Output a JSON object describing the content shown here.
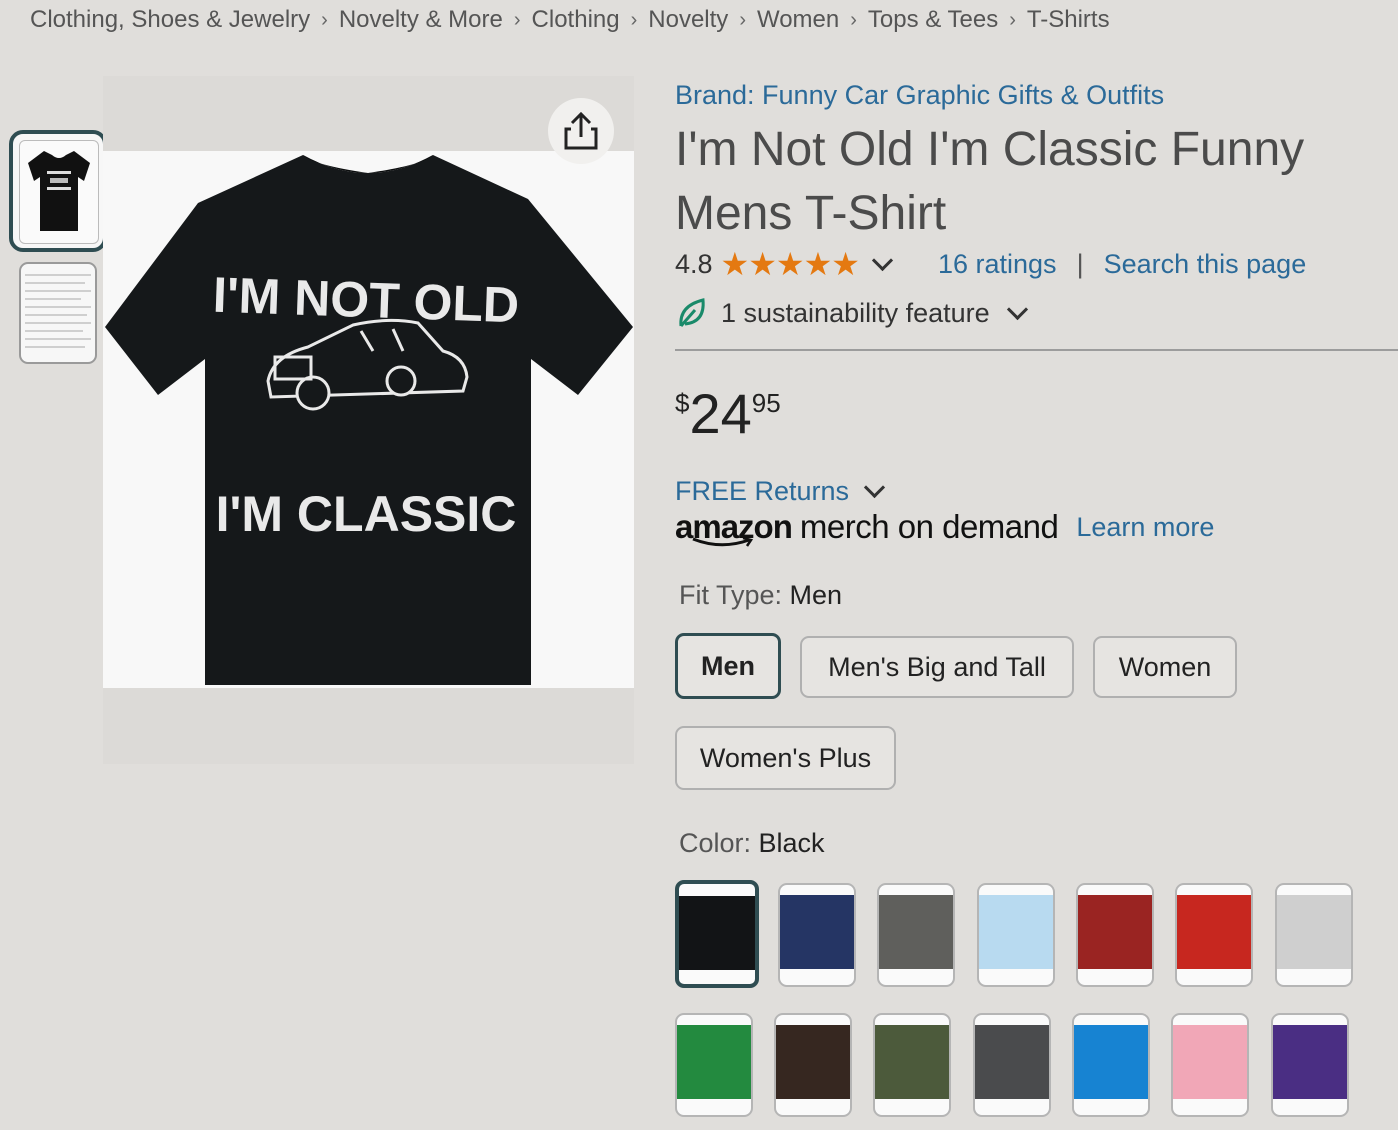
{
  "breadcrumb": [
    "Clothing, Shoes & Jewelry",
    "Novelty & More",
    "Clothing",
    "Novelty",
    "Women",
    "Tops & Tees",
    "T-Shirts"
  ],
  "breadcrumb_separator": "›",
  "product_image": {
    "shirt_line1": "I'M NOT OLD",
    "shirt_line2": "I'M CLASSIC"
  },
  "brand_link": "Brand: Funny Car Graphic Gifts & Outfits",
  "title": "I'm Not Old I'm Classic Funny Mens T-Shirt",
  "rating": {
    "value": "4.8",
    "stars": 4.8,
    "count_text": "16 ratings",
    "separator": "|",
    "search_text": "Search this page"
  },
  "sustainability": "1 sustainability feature",
  "price": {
    "symbol": "$",
    "whole": "24",
    "fraction": "95"
  },
  "returns": "FREE Returns",
  "merch": {
    "logo": "amazon",
    "text": "merch on demand",
    "learn_more": "Learn more"
  },
  "fit_type": {
    "label": "Fit Type: ",
    "value": "Men",
    "options": [
      "Men",
      "Men's Big and Tall",
      "Women",
      "Women's Plus"
    ],
    "selected": "Men"
  },
  "color": {
    "label": "Color: ",
    "value": "Black",
    "swatches": [
      "#121416",
      "#253564",
      "#5f5f5c",
      "#b8daf0",
      "#9a2422",
      "#c7271f",
      "#cfcfcf",
      "#238a3f",
      "#362720",
      "#4c5a3b",
      "#4a4b4d",
      "#1783d2",
      "#f1a7b7",
      "#4a2e83"
    ]
  },
  "colors": {
    "link": "#2b6a99",
    "star": "#e47911",
    "selected_border": "#2f4d52"
  }
}
